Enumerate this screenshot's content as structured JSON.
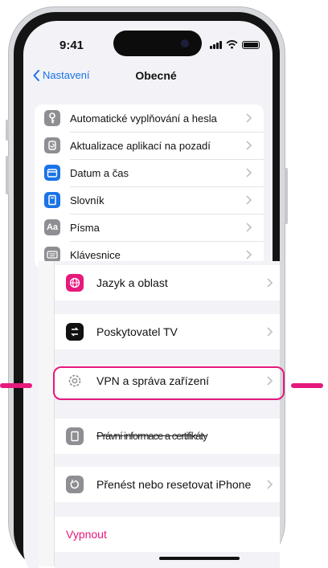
{
  "status": {
    "time": "9:41"
  },
  "nav": {
    "back_label": "Nastavení",
    "title": "Obecné"
  },
  "top_rows": [
    {
      "label": "Automatické vyplňování a hesla",
      "icon": "key-icon",
      "color": "#8e8e93"
    },
    {
      "label": "Aktualizace aplikací na pozadí",
      "icon": "refresh-icon",
      "color": "#8e8e93"
    },
    {
      "label": "Datum a čas",
      "icon": "calendar-icon",
      "color": "#1a73e8"
    },
    {
      "label": "Slovník",
      "icon": "book-icon",
      "color": "#1a73e8"
    },
    {
      "label": "Písma",
      "icon": "font-icon",
      "glyph": "Aa",
      "color": "#8e8e93"
    },
    {
      "label": "Klávesnice",
      "icon": "keyboard-icon",
      "color": "#8e8e93"
    }
  ],
  "zoom": {
    "jazyk": {
      "label": "Jazyk a oblast",
      "icon": "globe-icon",
      "color": "#e6197c"
    },
    "tv": {
      "label": "Poskytovatel TV",
      "icon": "tv-provider-icon",
      "color": "#111111"
    },
    "vpn": {
      "label": "VPN a správa zařízení",
      "icon": "gear-icon",
      "color": "#8e8e93"
    },
    "pravni": {
      "label": "Právní informace a certifikáty",
      "icon": "document-icon",
      "color": "#8e8e93"
    },
    "prenest": {
      "label": "Přenést nebo resetovat iPhone",
      "icon": "reset-icon",
      "color": "#8e8e93"
    },
    "vypnout": {
      "label": "Vypnout"
    }
  },
  "colors": {
    "accent": "#e6197c",
    "link": "#1a73e8"
  }
}
